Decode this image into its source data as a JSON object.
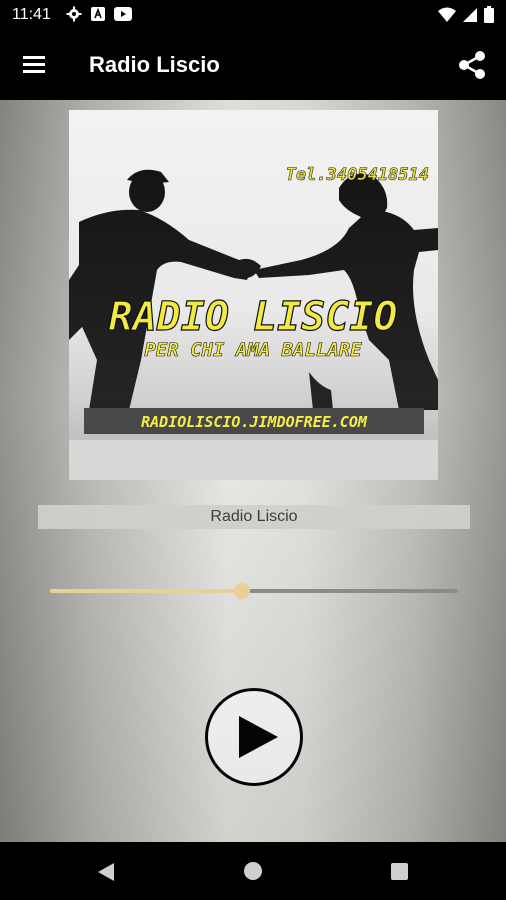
{
  "status_bar": {
    "time": "11:41",
    "left_icons": [
      "gear-icon",
      "a-badge-icon",
      "youtube-icon"
    ],
    "right_icons": [
      "wifi-icon",
      "signal-icon",
      "battery-icon"
    ]
  },
  "app_bar": {
    "title": "Radio Liscio",
    "menu_icon": "hamburger-menu-icon",
    "share_icon": "share-icon"
  },
  "cover": {
    "phone": "Tel.3405418514",
    "title": "RADIO LISCIO",
    "subtitle": "PER CHI AMA BALLARE",
    "website": "RADIOLISCIO.JIMDOFREE.COM",
    "text_color": "#f5ec3a"
  },
  "player": {
    "station_name": "Radio Liscio",
    "volume_fraction": 0.47,
    "play_icon": "play-icon",
    "accent_color": "#f7d79a"
  },
  "nav_bar": {
    "back_icon": "back-triangle-icon",
    "home_icon": "home-circle-icon",
    "recents_icon": "recents-square-icon"
  }
}
